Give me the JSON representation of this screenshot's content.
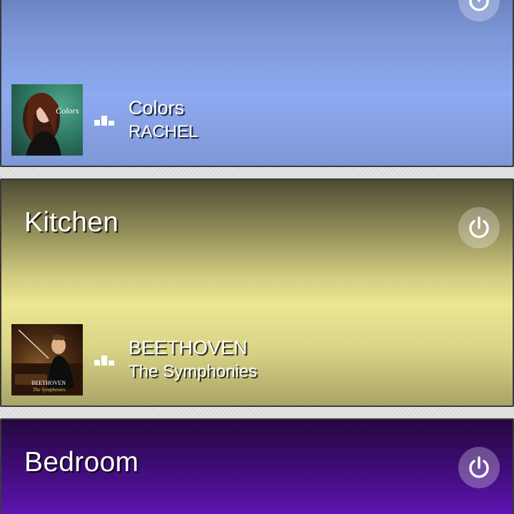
{
  "rooms": [
    {
      "name": "",
      "track": {
        "line1": "Colors",
        "line2": "RACHEL",
        "album_art_icon": "album-art-colors",
        "album_caption": "Colors"
      },
      "power_icon": "power-icon",
      "colors": {
        "top": "#4d5f99",
        "bottom": "#8eaaf0"
      }
    },
    {
      "name": "Kitchen",
      "track": {
        "line1": "BEETHOVEN",
        "line2": "The Symphonies",
        "album_art_icon": "album-art-beethoven",
        "album_caption_1": "BEETHOVEN",
        "album_caption_2": "The Symphonies"
      },
      "power_icon": "power-icon",
      "colors": {
        "top": "#4e4b33",
        "bottom": "#ebe692"
      }
    },
    {
      "name": "Bedroom",
      "power_icon": "power-icon",
      "colors": {
        "top": "#25083f",
        "bottom": "#6b16c8"
      }
    }
  ],
  "playing_indicator_icon": "equalizer-icon"
}
